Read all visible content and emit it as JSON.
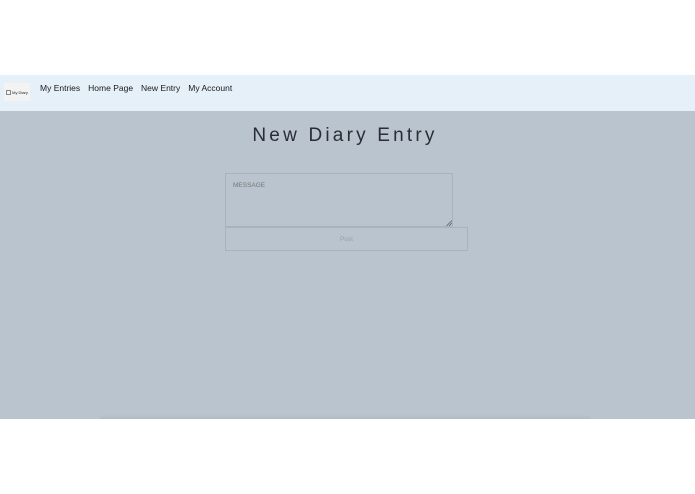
{
  "logo": {
    "alt_text": "My Diary"
  },
  "nav": {
    "items": [
      {
        "label": "My Entries"
      },
      {
        "label": "Home Page"
      },
      {
        "label": "New Entry"
      },
      {
        "label": "My Account"
      }
    ]
  },
  "main": {
    "title": "New Diary Entry",
    "message_placeholder": "MESSAGE",
    "post_label": "Post"
  },
  "colors": {
    "navbar_bg": "#e6f0f8",
    "main_bg": "#b9c4cf",
    "title_text": "#2a2d33"
  }
}
